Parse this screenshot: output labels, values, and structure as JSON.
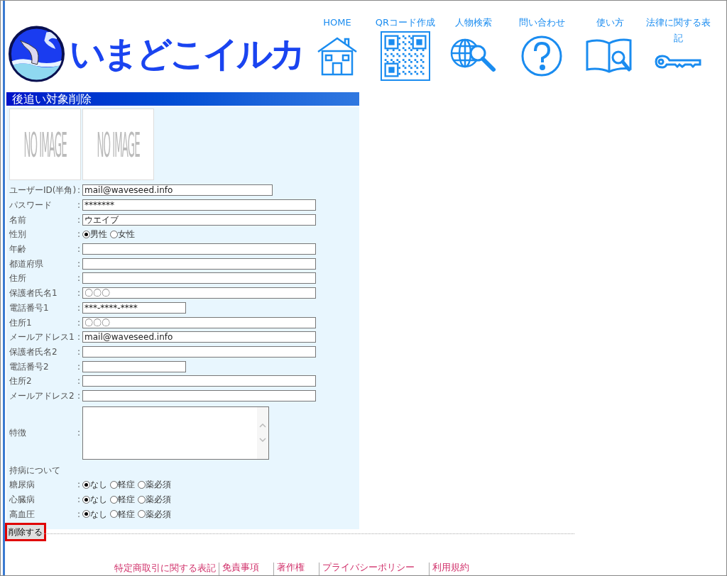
{
  "header": {
    "logo_text": "いまどこイルカ",
    "nav": [
      {
        "label": "HOME"
      },
      {
        "label": "QRコード作成"
      },
      {
        "label": "人物検索"
      },
      {
        "label": "問い合わせ"
      },
      {
        "label": "使い方"
      },
      {
        "label": "法律に関する表記"
      }
    ]
  },
  "section_title": "後追い対象削除",
  "images": [
    {
      "label": "NO IMAGE"
    },
    {
      "label": "NO IMAGE"
    }
  ],
  "form": [
    {
      "kind": "id",
      "label": "ユーザーID(半角)",
      "colon": ":",
      "value": "mail@waveseed.info"
    },
    {
      "kind": "text",
      "label": "パスワード",
      "colon": ":",
      "value": "*******"
    },
    {
      "kind": "text",
      "label": "名前",
      "colon": ":",
      "value": "ウエイブ"
    },
    {
      "kind": "radio",
      "label": "性別",
      "colon": ":",
      "options": [
        {
          "label": "男性",
          "selected": true
        },
        {
          "label": "女性",
          "selected": false
        }
      ]
    },
    {
      "kind": "text",
      "label": "年齢",
      "colon": ":"
    },
    {
      "kind": "text",
      "label": "都道府県",
      "colon": ":"
    },
    {
      "kind": "text",
      "label": "住所",
      "colon": ":"
    },
    {
      "kind": "text",
      "label": "保護者氏名1",
      "colon": ":",
      "value": "〇〇〇"
    },
    {
      "kind": "phone",
      "label": "電話番号1",
      "colon": ":",
      "value": "***-****-****"
    },
    {
      "kind": "text",
      "label": "住所1",
      "colon": ":",
      "value": "〇〇〇"
    },
    {
      "kind": "text",
      "label": "メールアドレス1",
      "colon": ":",
      "value": "mail@waveseed.info"
    },
    {
      "kind": "text",
      "label": "保護者氏名2",
      "colon": ":"
    },
    {
      "kind": "phone",
      "label": "電話番号2",
      "colon": ":"
    },
    {
      "kind": "text",
      "label": "住所2",
      "colon": ":"
    },
    {
      "kind": "text",
      "label": "メールアドレス2",
      "colon": ":"
    },
    {
      "kind": "textarea",
      "label": "特徴",
      "colon": ":"
    },
    {
      "kind": "heading",
      "label": "持病について"
    },
    {
      "kind": "radio",
      "label": "糖尿病",
      "colon": ":",
      "options": [
        {
          "label": "なし",
          "selected": true
        },
        {
          "label": "軽症",
          "selected": false
        },
        {
          "label": "薬必須",
          "selected": false
        }
      ]
    },
    {
      "kind": "radio",
      "label": "心臓病",
      "colon": ":",
      "options": [
        {
          "label": "なし",
          "selected": true
        },
        {
          "label": "軽症",
          "selected": false
        },
        {
          "label": "薬必須",
          "selected": false
        }
      ]
    },
    {
      "kind": "radio",
      "label": "高血圧",
      "colon": ":",
      "options": [
        {
          "label": "なし",
          "selected": true
        },
        {
          "label": "軽症",
          "selected": false
        },
        {
          "label": "薬必須",
          "selected": false
        }
      ]
    }
  ],
  "submit": {
    "label": "削除する",
    "highlighted": true
  },
  "footer_links": [
    "特定商取引に関する表記",
    "免責事項",
    "著作権",
    "プライバシーポリシー",
    "利用規約"
  ]
}
